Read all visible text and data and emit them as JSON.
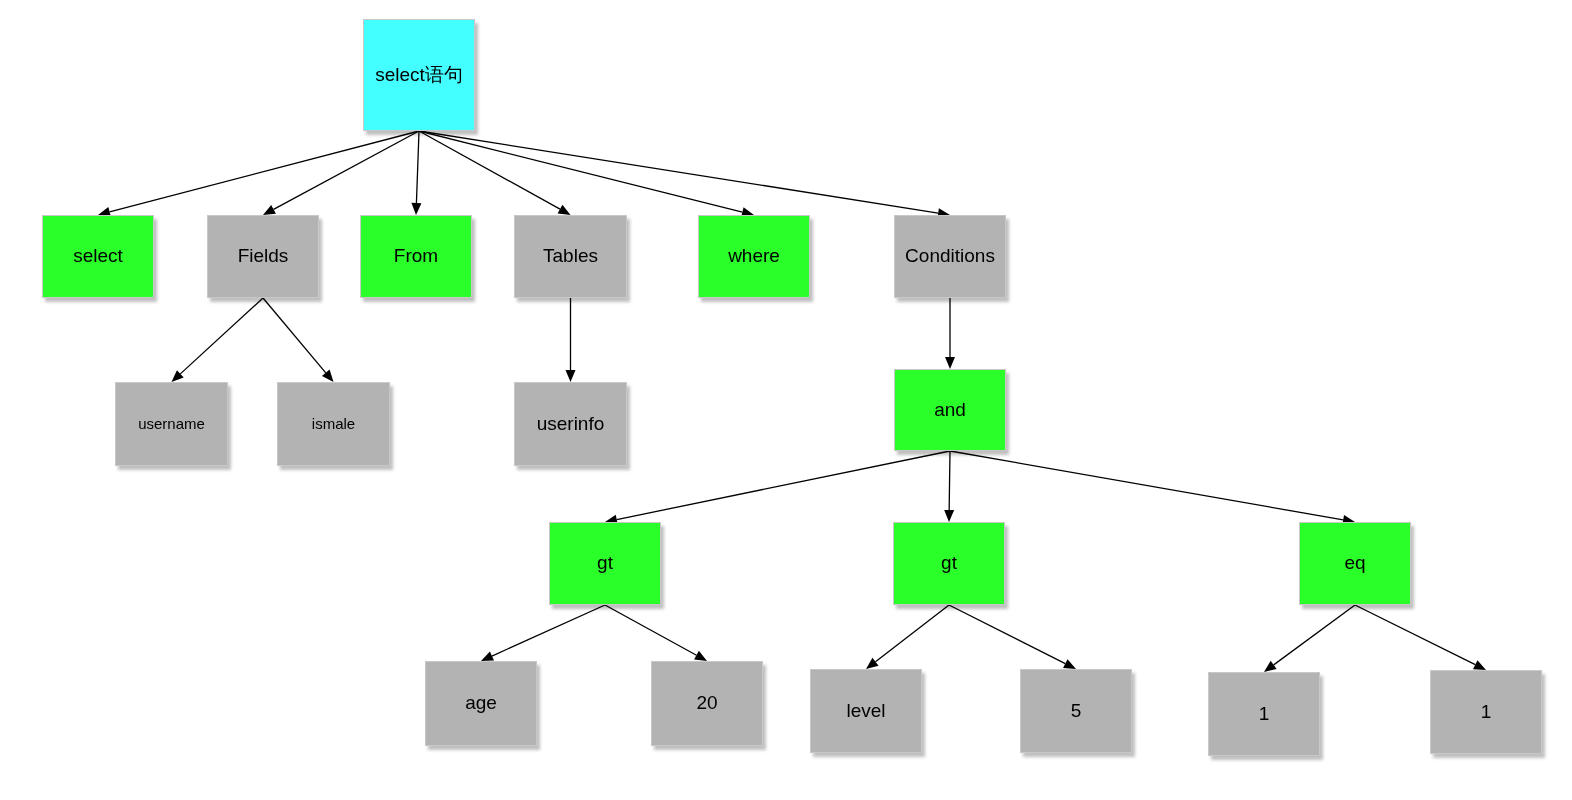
{
  "tree": {
    "label": "select语句",
    "kind": "root",
    "children": [
      {
        "label": "select",
        "kind": "keyword"
      },
      {
        "label": "Fields",
        "kind": "node",
        "children": [
          {
            "label": "username",
            "kind": "node"
          },
          {
            "label": "ismale",
            "kind": "node"
          }
        ]
      },
      {
        "label": "From",
        "kind": "keyword"
      },
      {
        "label": "Tables",
        "kind": "node",
        "children": [
          {
            "label": "userinfo",
            "kind": "node"
          }
        ]
      },
      {
        "label": "where",
        "kind": "keyword"
      },
      {
        "label": "Conditions",
        "kind": "node",
        "children": [
          {
            "label": "and",
            "kind": "keyword",
            "children": [
              {
                "label": "gt",
                "kind": "keyword",
                "children": [
                  {
                    "label": "age",
                    "kind": "node"
                  },
                  {
                    "label": "20",
                    "kind": "node"
                  }
                ]
              },
              {
                "label": "gt",
                "kind": "keyword",
                "children": [
                  {
                    "label": "level",
                    "kind": "node"
                  },
                  {
                    "label": "5",
                    "kind": "node"
                  }
                ]
              },
              {
                "label": "eq",
                "kind": "keyword",
                "children": [
                  {
                    "label": "1",
                    "kind": "node"
                  },
                  {
                    "label": "1",
                    "kind": "node"
                  }
                ]
              }
            ]
          }
        ]
      }
    ]
  }
}
